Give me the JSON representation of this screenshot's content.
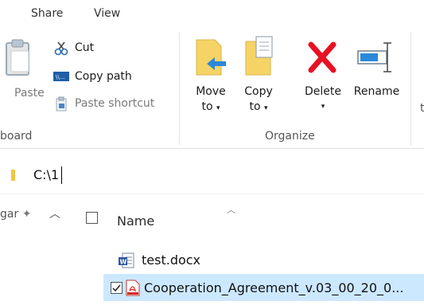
{
  "tabs": [
    "Share",
    "View"
  ],
  "clipboard": {
    "paste_label": "Paste",
    "cut_label": "Cut",
    "copy_path_label": "Copy path",
    "paste_shortcut_label": "Paste shortcut",
    "group_label": "board"
  },
  "organize": {
    "move_to_label_1": "Move",
    "move_to_label_2": "to",
    "copy_to_label_1": "Copy",
    "copy_to_label_2": "to",
    "delete_label": "Delete",
    "rename_label": "Rename",
    "group_label": "Organize"
  },
  "address": {
    "path": "C:\\1"
  },
  "nav": {
    "truncated_label": "gar"
  },
  "columns": {
    "name": "Name"
  },
  "files": [
    {
      "name": "test.docx",
      "type": "word",
      "selected": false
    },
    {
      "name": "Cooperation_Agreement_v.03_00_20_0...",
      "type": "pdf",
      "selected": true
    }
  ],
  "colors": {
    "accent_blue": "#0078d7",
    "delete_red": "#e81123",
    "folder_yellow": "#f6d365",
    "selection": "#cce8ff"
  }
}
